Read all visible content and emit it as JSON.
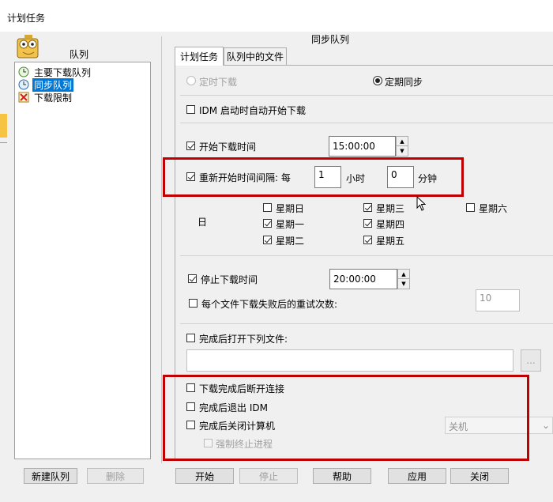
{
  "window": {
    "title": "计划任务"
  },
  "left": {
    "header": "队列",
    "tree": [
      {
        "label": "主要下载队列",
        "icon": "clock-queue-icon"
      },
      {
        "label": "同步队列",
        "icon": "sync-queue-icon",
        "selected": true
      },
      {
        "label": "下载限制",
        "icon": "limit-icon"
      }
    ],
    "new_queue_button": "新建队列",
    "delete_button": "删除"
  },
  "right": {
    "title": "同步队列",
    "tabs": [
      {
        "label": "计划任务",
        "active": true
      },
      {
        "label": "队列中的文件",
        "active": false
      }
    ],
    "schedule": {
      "one_time_label": "定时下载",
      "one_time_selected": false,
      "periodic_label": "定期同步",
      "periodic_selected": true
    },
    "start_on_idm_startup": {
      "label": "IDM 启动时自动开始下载",
      "checked": false
    },
    "start_download_time": {
      "label": "开始下载时间",
      "checked": true,
      "value": "15:00:00"
    },
    "restart_interval": {
      "label": "重新开始时间间隔: 每",
      "checked": true,
      "hours": "1",
      "hours_unit": "小时",
      "minutes": "0",
      "minutes_unit": "分钟"
    },
    "day_label": "日",
    "days": [
      {
        "label": "星期日",
        "checked": false
      },
      {
        "label": "星期三",
        "checked": true
      },
      {
        "label": "星期六",
        "checked": false
      },
      {
        "label": "星期一",
        "checked": true
      },
      {
        "label": "星期四",
        "checked": true
      },
      {
        "label": "星期二",
        "checked": true
      },
      {
        "label": "星期五",
        "checked": true
      }
    ],
    "stop_download_time": {
      "label": "停止下载时间",
      "checked": true,
      "value": "20:00:00"
    },
    "retry": {
      "label": "每个文件下载失败后的重试次数:",
      "checked": false,
      "value": "10"
    },
    "open_file_after": {
      "label": "完成后打开下列文件:",
      "checked": false,
      "path": "",
      "browse": "..."
    },
    "disconnect_after": {
      "label": "下载完成后断开连接",
      "checked": false
    },
    "exit_idm_after": {
      "label": "完成后退出 IDM",
      "checked": false
    },
    "shutdown_after": {
      "label": "完成后关闭计算机",
      "checked": false,
      "mode": "关机"
    },
    "force_terminate": {
      "label": "强制终止进程",
      "checked": false
    }
  },
  "footer": {
    "start": "开始",
    "stop": "停止",
    "help": "帮助",
    "apply": "应用",
    "close": "关闭"
  },
  "colors": {
    "highlight": "#c00000",
    "selection": "#0078d7"
  }
}
